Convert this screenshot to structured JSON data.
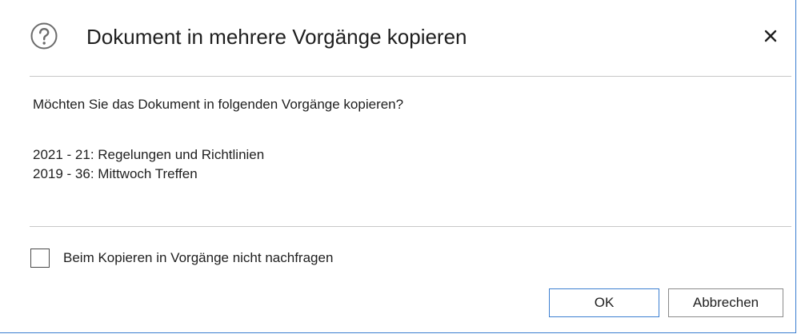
{
  "dialog": {
    "title": "Dokument in mehrere Vorgänge kopieren",
    "icon": "question-circle-icon",
    "close_icon": "close-icon",
    "message": "Möchten Sie das Dokument in folgenden Vorgänge kopieren?",
    "cases": [
      "2021 - 21: Regelungen und Richtlinien",
      "2019 - 36: Mittwoch Treffen"
    ],
    "checkbox": {
      "label": "Beim Kopieren in Vorgänge nicht nachfragen",
      "checked": false
    },
    "buttons": {
      "ok_label": "OK",
      "cancel_label": "Abbrechen"
    },
    "colors": {
      "accent": "#3c7fd1",
      "text": "#1f1f1f",
      "divider": "#c8c8c8"
    }
  }
}
